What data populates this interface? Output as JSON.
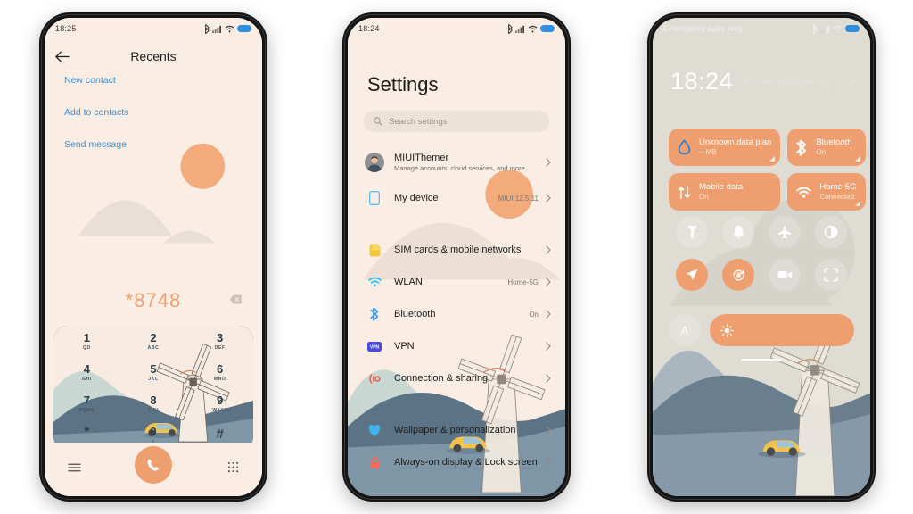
{
  "colors": {
    "accent_orange": "#ef9f6f",
    "cream_bg": "#faede3",
    "link_blue": "#3d8fd4",
    "hill_dark": "#5c7386",
    "hill_mid": "#7f96a6",
    "hill_sage": "#c9d7d3",
    "car_yellow": "#f2c14e",
    "battery_blue": "#2f8fe0",
    "cc_bg": "#dfdcd4"
  },
  "phone1": {
    "status": {
      "time": "18:25",
      "icons": [
        "bluetooth-icon",
        "signal-icon",
        "wifi-icon",
        "battery-icon"
      ]
    },
    "title": "Recents",
    "back_icon": "back-arrow-icon",
    "links": [
      "New contact",
      "Add to contacts",
      "Send message"
    ],
    "dialed_number": "*8748",
    "delete_icon": "backspace-icon",
    "keypad": [
      {
        "digit": "1",
        "letters": "QD"
      },
      {
        "digit": "2",
        "letters": "ABC"
      },
      {
        "digit": "3",
        "letters": "DEF"
      },
      {
        "digit": "4",
        "letters": "GHI"
      },
      {
        "digit": "5",
        "letters": "JKL"
      },
      {
        "digit": "6",
        "letters": "MNO"
      },
      {
        "digit": "7",
        "letters": "PQRS"
      },
      {
        "digit": "8",
        "letters": "TUV"
      },
      {
        "digit": "9",
        "letters": "WXYZ"
      },
      {
        "digit": "*",
        "letters": ","
      },
      {
        "digit": "0",
        "letters": "+"
      },
      {
        "digit": "#",
        "letters": ""
      }
    ],
    "bottom": {
      "menu_icon": "menu-icon",
      "call_icon": "call-icon",
      "keypad_icon": "keypad-icon"
    }
  },
  "phone2": {
    "status": {
      "time": "18:24"
    },
    "title": "Settings",
    "search": {
      "placeholder": "Search settings",
      "icon": "search-icon"
    },
    "account": {
      "name": "MIUIThemer",
      "subtitle": "Manage accounts, cloud services, and more",
      "avatar": "user-avatar"
    },
    "items": [
      {
        "label": "My device",
        "value": "MIUI 12.5.11",
        "icon": "device-icon",
        "color": "#5ec2f0"
      },
      {
        "label": "SIM cards & mobile networks",
        "value": "",
        "icon": "sim-icon",
        "color": "#f5c53a"
      },
      {
        "label": "WLAN",
        "value": "Home-5G",
        "icon": "wifi-icon",
        "color": "#36c0f0"
      },
      {
        "label": "Bluetooth",
        "value": "On",
        "icon": "bluetooth-icon",
        "color": "#3a9cf0"
      },
      {
        "label": "VPN",
        "value": "",
        "icon": "vpn-icon",
        "color": "#4a4ae0"
      },
      {
        "label": "Connection & sharing",
        "value": "",
        "icon": "connection-icon",
        "color": "#ea5a4c"
      },
      {
        "label": "Wallpaper & personalization",
        "value": "",
        "icon": "wallpaper-icon",
        "color": "#3fb3f0"
      },
      {
        "label": "Always-on display & Lock screen",
        "value": "",
        "icon": "lock-icon",
        "color": "#f36a56"
      }
    ],
    "chevron": "chevron-right-icon"
  },
  "phone3": {
    "status": {
      "carrier": "Emergency calls only"
    },
    "clock": {
      "time": "18:24",
      "date": "Thursday, September 05"
    },
    "actions": [
      {
        "name": "settings-gear-icon"
      },
      {
        "name": "edit-icon"
      }
    ],
    "tiles": [
      {
        "title": "Unknown data plan",
        "sub": "-- MB",
        "icon": "data-usage-icon",
        "corner": true
      },
      {
        "title": "Bluetooth",
        "sub": "On",
        "icon": "bluetooth-icon",
        "corner": true
      },
      {
        "title": "Mobile data",
        "sub": "On",
        "icon": "mobile-data-icon",
        "corner": false
      },
      {
        "title": "Home-5G",
        "sub": "Connected",
        "icon": "wifi-icon",
        "corner": true
      }
    ],
    "toggles": [
      {
        "name": "flashlight-icon",
        "on": false
      },
      {
        "name": "silent-bell-icon",
        "on": false
      },
      {
        "name": "airplane-mode-icon",
        "on": false
      },
      {
        "name": "dark-mode-icon",
        "on": false
      },
      {
        "name": "location-icon",
        "on": true
      },
      {
        "name": "auto-rotate-icon",
        "on": true
      },
      {
        "name": "screen-recorder-icon",
        "on": false
      },
      {
        "name": "screenshot-icon",
        "on": false
      }
    ],
    "brightness": {
      "auto_label": "A",
      "icon": "sun-icon"
    }
  }
}
